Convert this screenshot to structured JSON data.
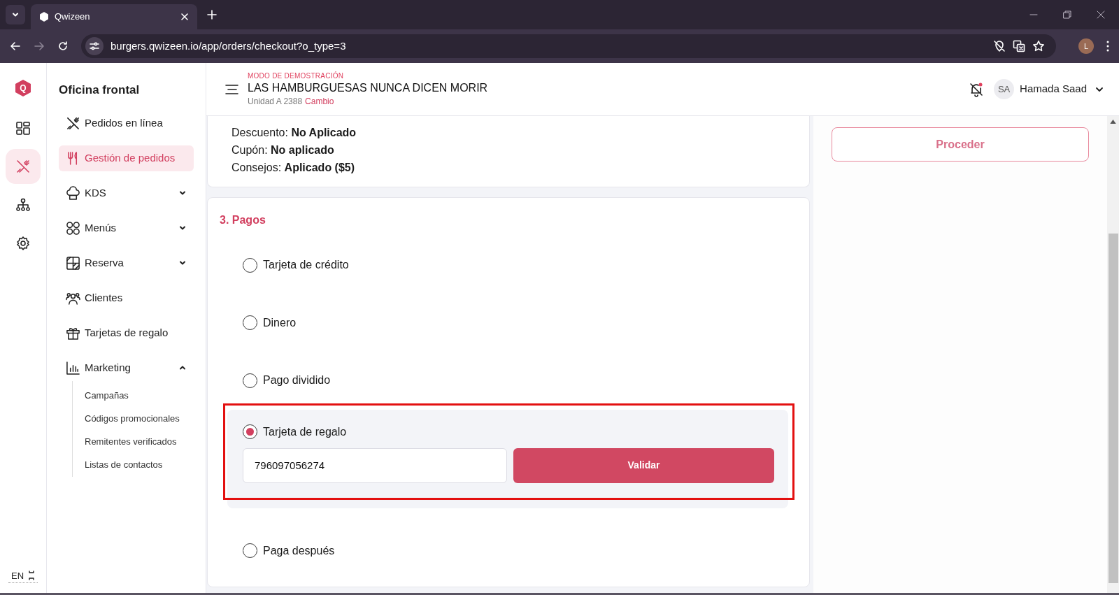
{
  "browser": {
    "tab_title": "Qwizeen",
    "url": "burgers.qwizeen.io/app/orders/checkout?o_type=3",
    "profile_initial": "L"
  },
  "rail": {
    "logo_letter": "Q",
    "items": [
      {
        "kind": "dashboard",
        "selected": false
      },
      {
        "kind": "dining",
        "selected": true
      },
      {
        "kind": "hierarchy",
        "selected": false
      },
      {
        "kind": "settings",
        "selected": false
      }
    ],
    "language": "EN"
  },
  "sidebar": {
    "title": "Oficina frontal",
    "items": [
      {
        "label": "Pedidos en línea",
        "kind": "utensils-cross",
        "selected": false
      },
      {
        "label": "Gestión de pedidos",
        "kind": "fork-knife",
        "selected": true
      },
      {
        "label": "KDS",
        "kind": "chef-hat",
        "selected": false,
        "expanded": false
      },
      {
        "label": "Menús",
        "kind": "grid",
        "selected": false,
        "expanded": false
      },
      {
        "label": "Reserva",
        "kind": "table",
        "selected": false,
        "expanded": false
      },
      {
        "label": "Clientes",
        "kind": "users",
        "selected": false
      },
      {
        "label": "Tarjetas de regalo",
        "kind": "gift",
        "selected": false
      },
      {
        "label": "Marketing",
        "kind": "chart",
        "selected": false,
        "expanded": true,
        "children": [
          {
            "label": "Campañas"
          },
          {
            "label": "Códigos promocionales"
          },
          {
            "label": "Remitentes verificados"
          },
          {
            "label": "Listas de contactos"
          }
        ]
      }
    ]
  },
  "header": {
    "demo_label": "MODO DE DEMOSTRACIÓN",
    "store_name": "LAS HAMBURGUESAS NUNCA DICEN MORIR",
    "unit": "Unidad A 2388",
    "change_link": "Cambio",
    "user_initials": "SA",
    "user_name": "Hamada Saad"
  },
  "summary": [
    {
      "label": "Descuento:",
      "value": "No Aplicado"
    },
    {
      "label": "Cupón:",
      "value": "No aplicado"
    },
    {
      "label": "Consejos:",
      "value": "Aplicado ($5)"
    }
  ],
  "payments": {
    "title": "3. Pagos",
    "options": [
      {
        "label": "Tarjeta de crédito",
        "kind": "plain",
        "selected": false
      },
      {
        "label": "Dinero",
        "kind": "plain",
        "selected": false
      },
      {
        "label": "Pago dividido",
        "kind": "plain",
        "selected": false
      },
      {
        "label": "Tarjeta de regalo",
        "kind": "gift_card",
        "selected": true,
        "highlighted": true,
        "code": "796097056274",
        "button": "Validar"
      },
      {
        "label": "Paga después",
        "kind": "plain",
        "selected": false
      }
    ]
  },
  "proceed_button": "Proceder"
}
